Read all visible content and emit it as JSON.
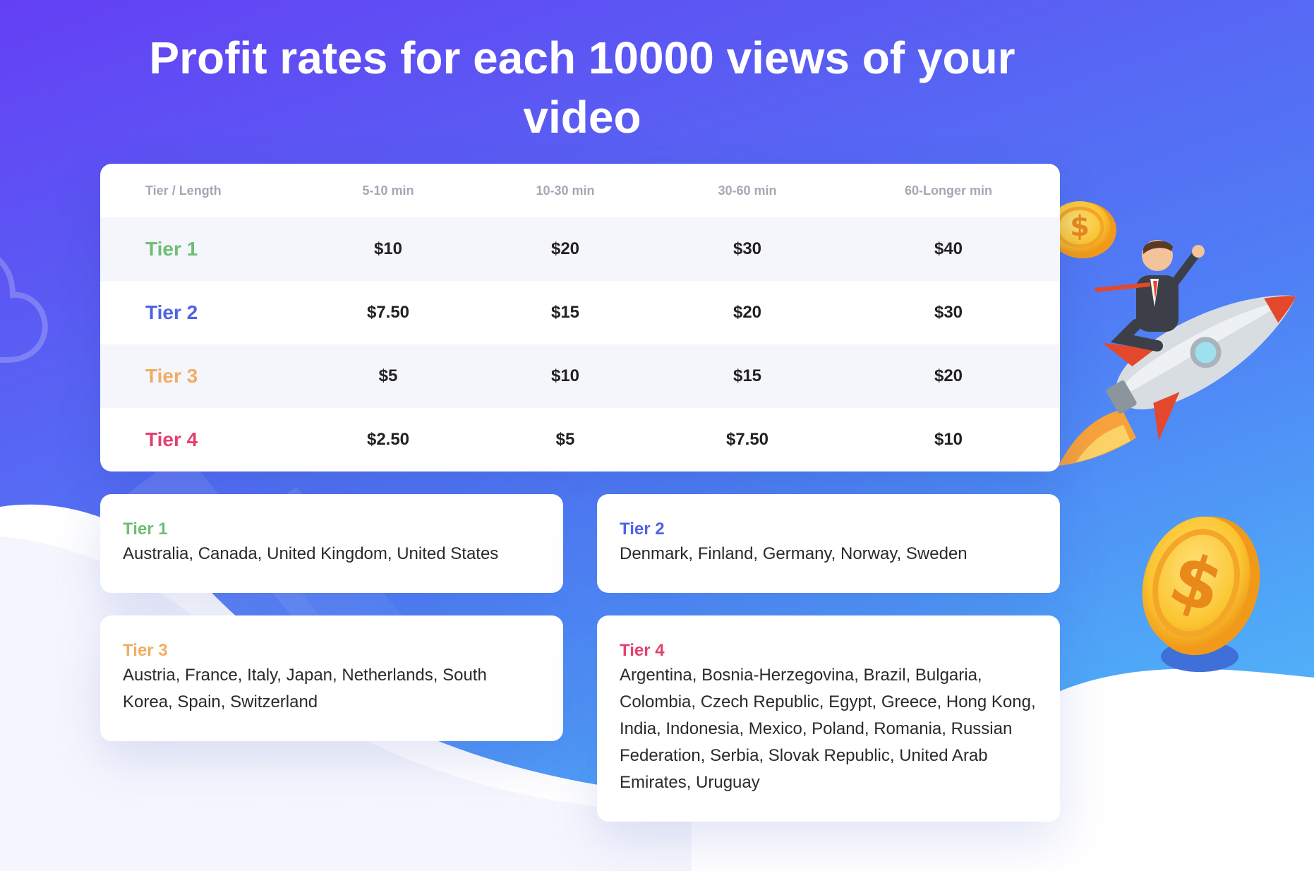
{
  "title": "Profit rates for each 10000 views of your video",
  "colors": {
    "tier1": "#6dbf73",
    "tier2": "#4f63e6",
    "tier3": "#f0ad62",
    "tier4": "#e3416e"
  },
  "table": {
    "headers": [
      "Tier / Length",
      "5-10 min",
      "10-30 min",
      "30-60 min",
      "60-Longer min"
    ],
    "rows": [
      {
        "tier": "Tier 1",
        "values": [
          "$10",
          "$20",
          "$30",
          "$40"
        ]
      },
      {
        "tier": "Tier 2",
        "values": [
          "$7.50",
          "$15",
          "$20",
          "$30"
        ]
      },
      {
        "tier": "Tier 3",
        "values": [
          "$5",
          "$10",
          "$15",
          "$20"
        ]
      },
      {
        "tier": "Tier 4",
        "values": [
          "$2.50",
          "$5",
          "$7.50",
          "$10"
        ]
      }
    ]
  },
  "tier_cards": [
    {
      "title": "Tier 1",
      "countries": "Australia, Canada, United Kingdom, United States"
    },
    {
      "title": "Tier 2",
      "countries": "Denmark, Finland, Germany, Norway, Sweden"
    },
    {
      "title": "Tier 3",
      "countries": "Austria, France, Italy, Japan, Netherlands, South Korea, Spain, Switzerland"
    },
    {
      "title": "Tier 4",
      "countries": "Argentina, Bosnia-Herzegovina, Brazil, Bulgaria, Colombia, Czech Republic, Egypt, Greece, Hong Kong, India, Indonesia, Mexico, Poland, Romania, Russian Federation, Serbia, Slovak Republic, United Arab Emirates, Uruguay"
    }
  ],
  "illustrations": [
    "cloud-outline-icon",
    "coin-icon",
    "rocket-businessman-illustration",
    "large-coin-icon"
  ]
}
